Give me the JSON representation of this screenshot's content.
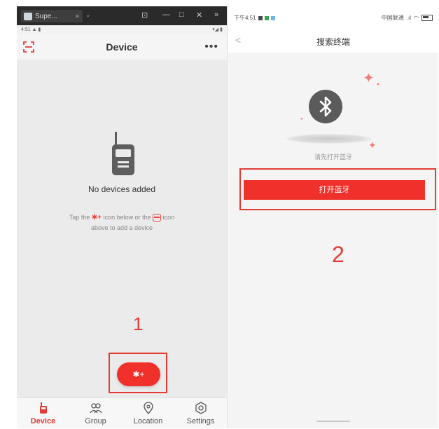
{
  "left_phone": {
    "window": {
      "tab_title": "Supe...",
      "tab_close": "×",
      "tab_dropdown": "⌄",
      "controls": [
        "⊡",
        "—",
        "□",
        "✕",
        "»"
      ]
    },
    "status": {
      "left": "4:51 ▲ ▮",
      "right": "▾◢ ▮"
    },
    "header": {
      "title": "Device",
      "more": "•••",
      "scan_icon": "scan-icon"
    },
    "empty_state": {
      "title": "No devices added",
      "hint_part1": "Tap the",
      "hint_bt": "✱+",
      "hint_part2": "icon below or the",
      "hint_part3": "icon",
      "hint_line2": "above to add a device"
    },
    "step_label": "1",
    "fab": {
      "label": "✱+",
      "icon": "bluetooth-add-icon"
    },
    "tabs": [
      {
        "label": "Device",
        "icon": "radio-icon",
        "active": true
      },
      {
        "label": "Group",
        "icon": "group-icon",
        "active": false
      },
      {
        "label": "Location",
        "icon": "location-icon",
        "active": false
      },
      {
        "label": "Settings",
        "icon": "settings-icon",
        "active": false
      }
    ]
  },
  "right_phone": {
    "status": {
      "time": "下午4:51",
      "carrier": "中国联通",
      "signal": ".ıl",
      "wifi": "◠"
    },
    "header": {
      "back": "<",
      "title": "搜索终端"
    },
    "caption": "请先打开蓝牙",
    "button_label": "打开蓝牙",
    "step_label": "2",
    "colors": {
      "accent": "#f0312b",
      "highlight": "#e23b35"
    }
  }
}
